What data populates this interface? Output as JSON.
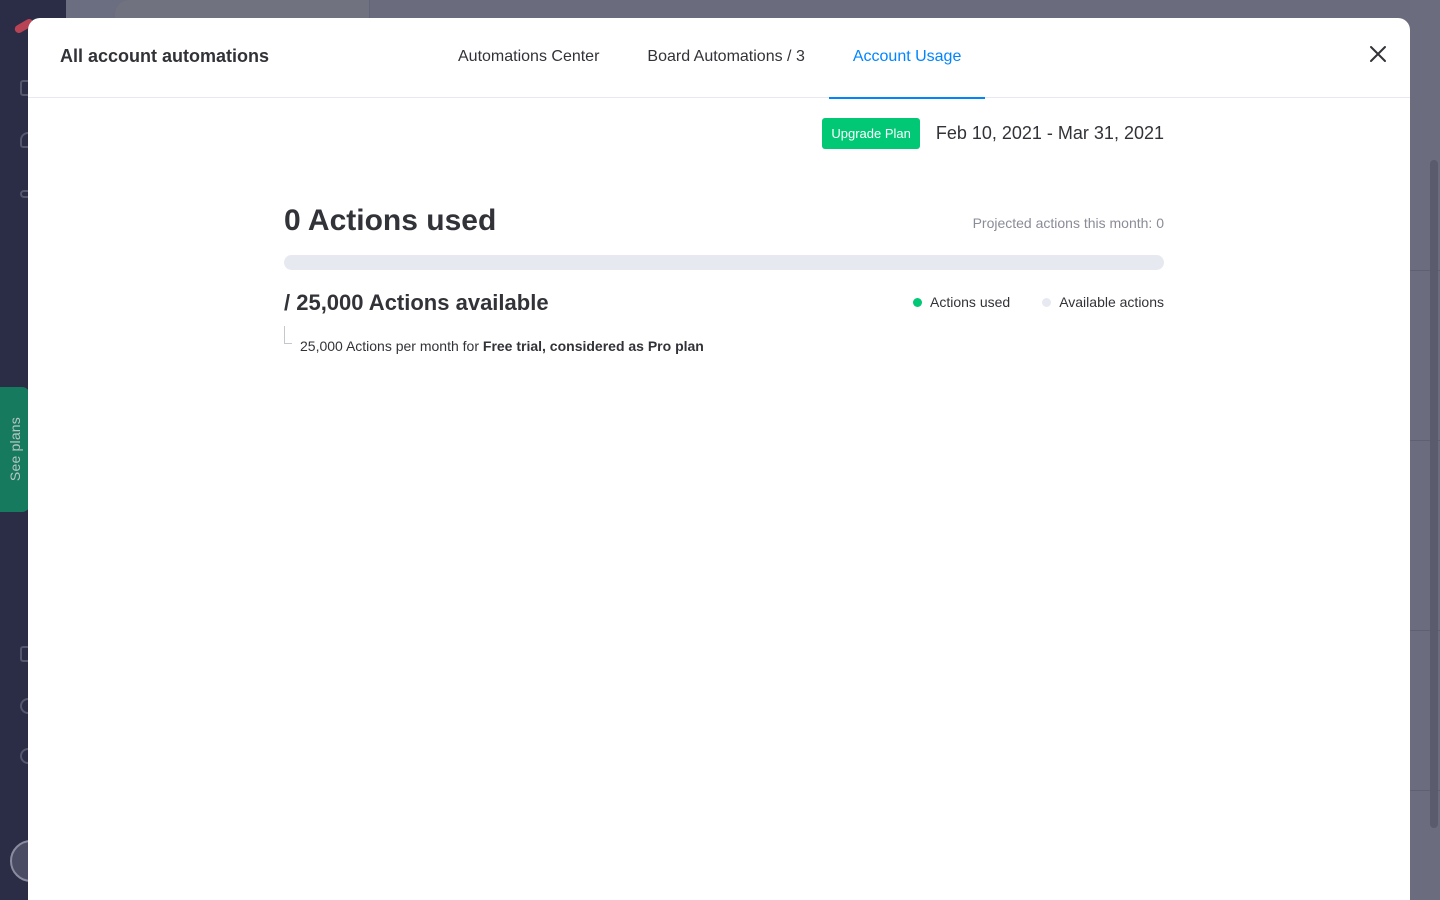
{
  "modal": {
    "title": "All account automations",
    "tabs": [
      {
        "label": "Automations Center",
        "active": false
      },
      {
        "label": "Board Automations / 3",
        "active": false
      },
      {
        "label": "Account Usage",
        "active": true
      }
    ],
    "close_icon": "close-icon"
  },
  "usage": {
    "upgrade_label": "Upgrade Plan",
    "date_range": "Feb 10, 2021 - Mar 31, 2021",
    "actions_used_title": "0 Actions used",
    "projected_text": "Projected actions this month: 0",
    "progress_fraction": 0,
    "actions_available_title": "/ 25,000 Actions available",
    "legend": {
      "used_label": "Actions used",
      "available_label": "Available actions"
    },
    "plan_note_prefix": "25,000 Actions per month for ",
    "plan_note_plan": "Free trial, considered as Pro plan"
  },
  "background": {
    "see_plans_label": "See plans"
  },
  "colors": {
    "accent": "#0085ff",
    "success": "#00c875",
    "track": "#e6e9ef"
  }
}
